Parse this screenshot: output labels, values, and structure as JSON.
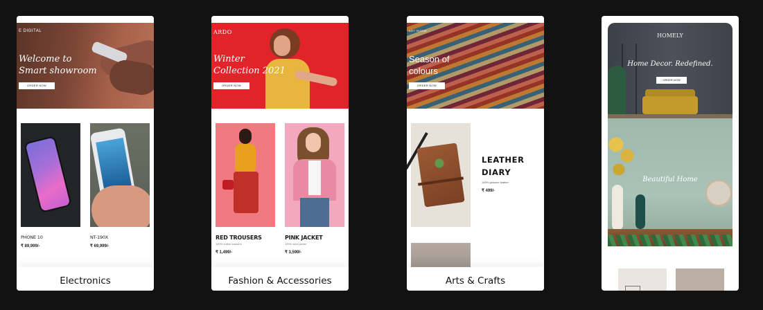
{
  "cards": {
    "electronics": {
      "brand": "E DIGITAL",
      "hero_title": "Welcome to\nSmart showroom",
      "hero_button": "ORDER NOW",
      "products": [
        {
          "name": "PHONE 10",
          "price": "₹ 89,999/-"
        },
        {
          "name": "NT-190X",
          "price": "₹ 69,999/-"
        }
      ],
      "caption": "Electronics"
    },
    "fashion": {
      "brand": "ARDO",
      "hero_title": "Winter\nCollection 2021",
      "hero_button": "ORDER NOW",
      "products": [
        {
          "name": "RED TROUSERS",
          "sub": "100% cotton trousers",
          "price": "₹ 1,499/-"
        },
        {
          "name": "PINK JACKET",
          "sub": "100% wool jacket",
          "price": "₹ 3,599/-"
        }
      ],
      "caption": "Fashion & Accessories"
    },
    "arts": {
      "brand": "ART ROOM",
      "hero_title": "Season of\ncolours",
      "hero_button": "ORDER NOW",
      "product": {
        "name": "LEATHER\nDIARY",
        "sub": "100% genuine leather",
        "price": "₹ 499/-"
      },
      "caption": "Arts & Crafts"
    },
    "home": {
      "brand": "HOMELY",
      "hero_title": "Home Decor. Redefined.",
      "hero_button": "ORDER NOW",
      "section_title": "Beautiful Home"
    }
  },
  "colors": {
    "page_bg": "#121212",
    "card_bg": "#ffffff",
    "fashion_red": "#e0242a",
    "electronics_brown": "#7b4636"
  }
}
